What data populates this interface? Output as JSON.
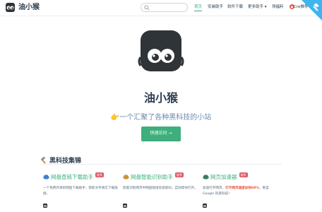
{
  "nav": {
    "site_name": "油小猴",
    "search_placeholder": "",
    "items": [
      {
        "label": "首页",
        "active": true
      },
      {
        "label": "安装助手",
        "active": false
      },
      {
        "label": "软件下载",
        "active": false
      },
      {
        "label": "更多助手 ▾",
        "active": false
      },
      {
        "label": "领福利",
        "active": false
      },
      {
        "label": "Cre推荐",
        "active": false
      }
    ]
  },
  "hero": {
    "title": "油小猴",
    "description": "👉一个汇聚了各种黑科技的小站",
    "button_label": "快速访问 →"
  },
  "section": {
    "title": "黑科技集锦",
    "icon": "hammer-icon"
  },
  "cards": [
    {
      "title": "网盘直链下载助手",
      "tag": "推荐",
      "tag_color": "#da5961",
      "desc_segments": [
        {
          "text": "一个免费开源的网盘下载助手，获取文件真实下载链接。",
          "style": "normal"
        }
      ]
    },
    {
      "title": "网盘智能识别助手",
      "tag": "推荐",
      "tag_color": "#da5961",
      "desc_segments": [
        {
          "text": "智能识别网页中网盘链接及提取码，自动帮你打开。",
          "style": "normal"
        }
      ]
    },
    {
      "title": "网页加速器",
      "tag": "推荐",
      "tag_color": "#da5961",
      "desc_segments": [
        {
          "text": "加速打开网页，",
          "style": "normal"
        },
        {
          "text": "打开网页速度加快60%",
          "style": "bold"
        },
        {
          "text": "，来自 Google 的黑科技！",
          "style": "normal"
        }
      ]
    }
  ],
  "colors": {
    "accent": "#3eaf7c",
    "text": "#2c3e50",
    "muted": "#6a8bad",
    "tag_red": "#da5961",
    "corner": "#3eb5f0"
  }
}
